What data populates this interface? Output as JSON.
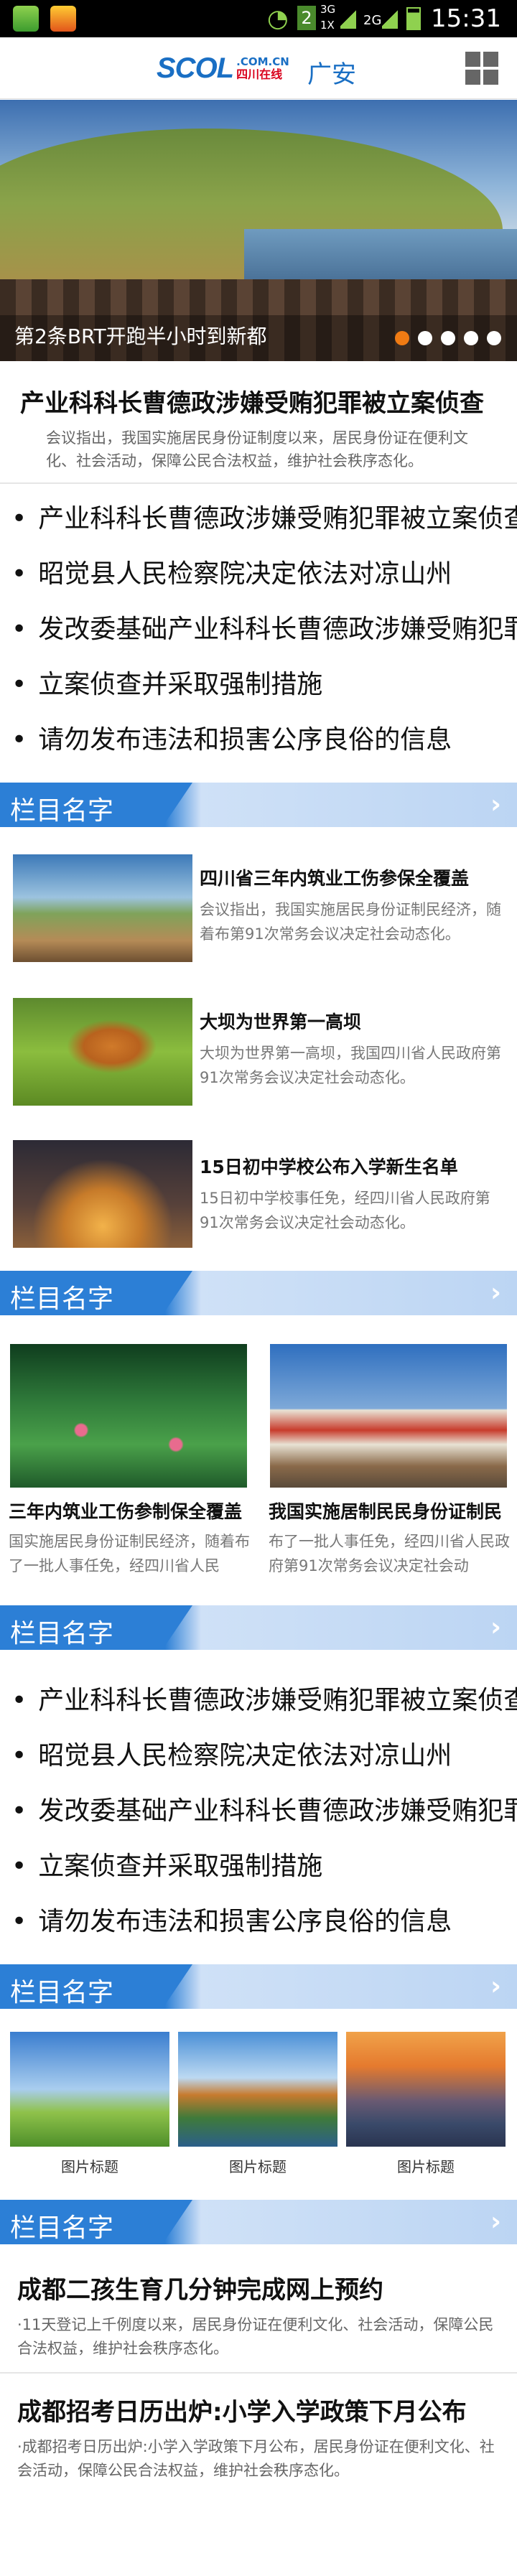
{
  "status_bar": {
    "time": "15:31",
    "sim_badge": "2",
    "net_3g": "3G",
    "net_1x": "1X",
    "net_2g": "2G"
  },
  "header": {
    "logo_brand": "SCOL",
    "logo_domain": ".COM.CN",
    "logo_cn": "四川在线",
    "city": "广安",
    "menu_icon": "grid-icon"
  },
  "banner": {
    "caption": "第2条BRT开跑半小时到新都",
    "dots": 5,
    "active_dot": 0
  },
  "headline": {
    "title": "产业科科长曹德政涉嫌受贿犯罪被立案侦查",
    "desc": "会议指出，我国实施居民身份证制度以来，居民身份证在便利文化、社会活动，保障公民合法权益，维护社会秩序态化。"
  },
  "list1": [
    "产业科科长曹德政涉嫌受贿犯罪被立案侦查",
    "昭觉县人民检察院决定依法对凉山州",
    "发改委基础产业科科长曹德政涉嫌受贿犯罪",
    "立案侦查并采取强制措施",
    "请勿发布违法和损害公序良俗的信息"
  ],
  "sections": {
    "s1": "栏目名字",
    "s2": "栏目名字",
    "s3": "栏目名字",
    "s4": "栏目名字",
    "s5": "栏目名字",
    "arrow": "›"
  },
  "news": [
    {
      "title": "四川省三年内筑业工伤参保全覆盖",
      "desc": "会议指出，我国实施居民身份证制民经济，随着布第91次常务会议决定社会动态化。"
    },
    {
      "title": "大坝为世界第一高坝",
      "desc": "大坝为世界第一高坝，我国四川省人民政府第91次常务会议决定社会动态化。"
    },
    {
      "title": "15日初中学校公布入学新生名单",
      "desc": "15日初中学校事任免，经四川省人民政府第91次常务会议决定社会动态化。"
    }
  ],
  "cards": [
    {
      "title": "三年内筑业工伤参制保全覆盖",
      "desc": "国实施居民身份证制民经济，随着布了一批人事任免，经四川省人民"
    },
    {
      "title": "我国实施居制民民身份证制民",
      "desc": "布了一批人事任免，经四川省人民政府第91次常务会议决定社会动"
    }
  ],
  "list2": [
    "产业科科长曹德政涉嫌受贿犯罪被立案侦查",
    "昭觉县人民检察院决定依法对凉山州",
    "发改委基础产业科科长曹德政涉嫌受贿犯罪",
    "立案侦查并采取强制措施",
    "请勿发布违法和损害公序良俗的信息"
  ],
  "gallery": [
    "图片标题",
    "图片标题",
    "图片标题"
  ],
  "articles": [
    {
      "title": "成都二孩生育几分钟完成网上预约",
      "desc": "·11天登记上千例度以来，居民身份证在便利文化、社会活动，保障公民合法权益，维护社会秩序态化。"
    },
    {
      "title": "成都招考日历出炉:小学入学政策下月公布",
      "desc": "·成都招考日历出炉:小学入学政策下月公布，居民身份证在便利文化、社会活动，保障公民合法权益，维护社会秩序态化。"
    }
  ]
}
